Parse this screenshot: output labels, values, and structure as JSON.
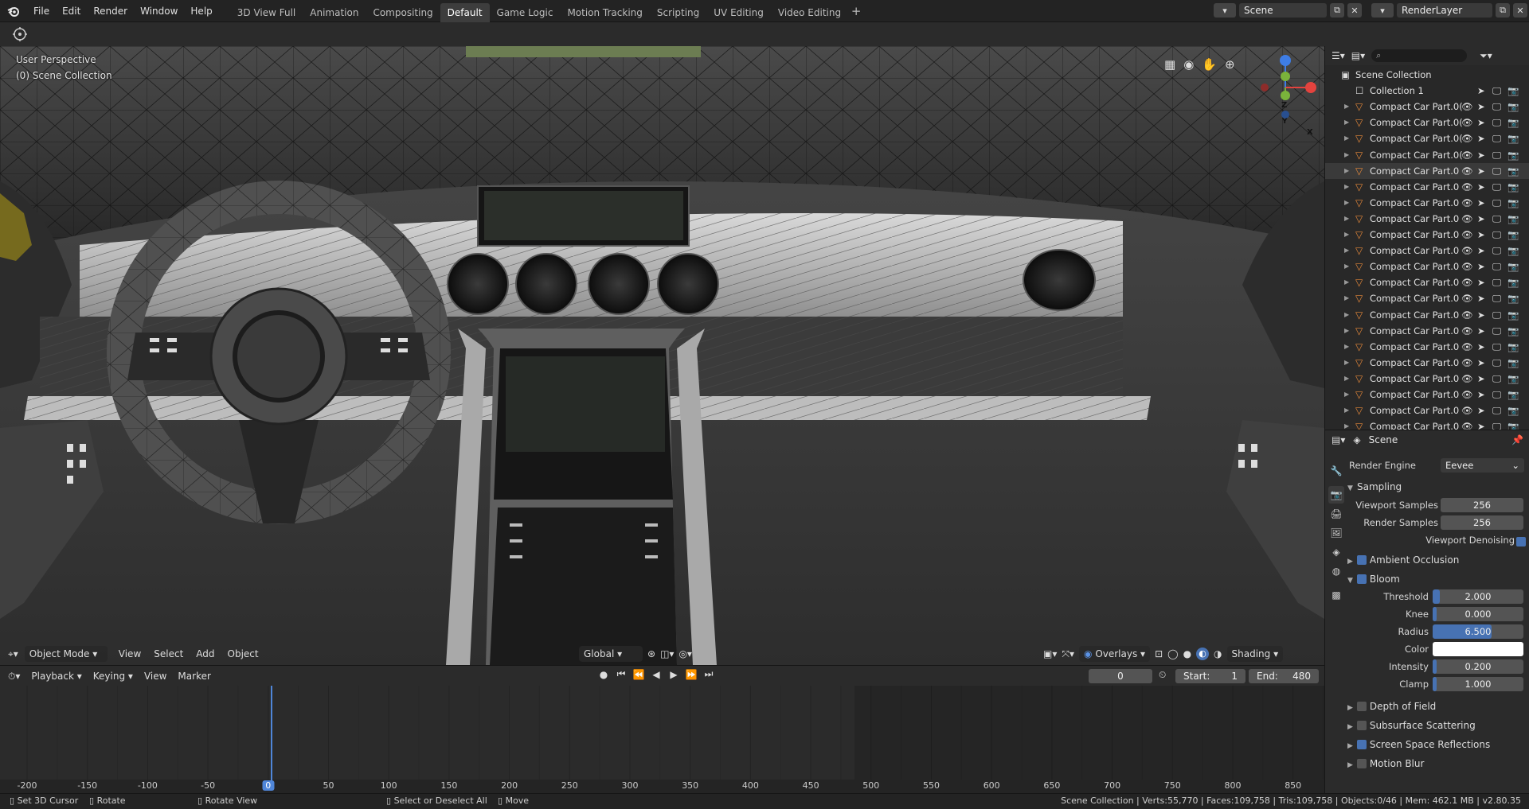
{
  "topbar": {
    "menus": [
      "File",
      "Edit",
      "Render",
      "Window",
      "Help"
    ],
    "workspaces": [
      "3D View Full",
      "Animation",
      "Compositing",
      "Default",
      "Game Logic",
      "Motion Tracking",
      "Scripting",
      "UV Editing",
      "Video Editing"
    ],
    "active_workspace": "Default",
    "add_tab": "+",
    "scene_name": "Scene",
    "view_layer": "RenderLayer"
  },
  "viewport": {
    "perspective": "User Perspective",
    "collection": "(0) Scene Collection",
    "mode": "Object Mode",
    "menus": [
      "View",
      "Select",
      "Add",
      "Object"
    ],
    "orientation": "Global",
    "overlays_label": "Overlays",
    "shading_label": "Shading",
    "gizmo_axes": {
      "z": "Z",
      "x": "X",
      "y": "Y"
    },
    "colors": {
      "x_axis": "#e4433e",
      "y_axis": "#7ab33b",
      "z_axis": "#3e7de6"
    }
  },
  "timeline": {
    "menus": [
      "Playback",
      "Keying",
      "View",
      "Marker"
    ],
    "current_frame": "0",
    "start_label": "Start:",
    "start_value": "1",
    "end_label": "End:",
    "end_value": "480",
    "ruler": [
      "-200",
      "-150",
      "-100",
      "-50",
      "0",
      "50",
      "100",
      "150",
      "200",
      "250",
      "300",
      "350",
      "400",
      "450",
      "500",
      "550",
      "600",
      "650",
      "700",
      "750",
      "800",
      "850"
    ],
    "playhead_color": "#4f86d9"
  },
  "statusbar": {
    "left": [
      {
        "icon": "mouse-left-icon",
        "label": "Set 3D Cursor"
      },
      {
        "icon": "mouse-middle-icon",
        "label": "Rotate"
      },
      {
        "icon": "mouse-right-icon",
        "label": "Rotate View"
      },
      {
        "icon": "mouse-left-icon",
        "label": "Select or Deselect All"
      },
      {
        "icon": "mouse-drag-icon",
        "label": "Move"
      }
    ],
    "stats": "Scene Collection | Verts:55,770 | Faces:109,758 | Tris:109,758 | Objects:0/46 | Mem: 462.1 MB | v2.80.35"
  },
  "outliner": {
    "root": "Scene Collection",
    "collection": "Collection 1",
    "items": [
      "Compact Car Part.0(",
      "Compact Car Part.0(",
      "Compact Car Part.0(",
      "Compact Car Part.0(",
      "Compact Car Part.0",
      "Compact Car Part.0",
      "Compact Car Part.0",
      "Compact Car Part.0",
      "Compact Car Part.0",
      "Compact Car Part.0",
      "Compact Car Part.0",
      "Compact Car Part.0",
      "Compact Car Part.0",
      "Compact Car Part.0",
      "Compact Car Part.0",
      "Compact Car Part.0",
      "Compact Car Part.0",
      "Compact Car Part.0",
      "Compact Car Part.0",
      "Compact Car Part.0",
      "Compact Car Part.0"
    ],
    "selected_index": 4,
    "mesh_color": "#e8893a"
  },
  "properties": {
    "context": "Scene",
    "render_engine_label": "Render Engine",
    "render_engine": "Eevee",
    "sampling": {
      "title": "Sampling",
      "viewport_samples_label": "Viewport Samples",
      "viewport_samples": "256",
      "render_samples_label": "Render Samples",
      "render_samples": "256",
      "denoising_label": "Viewport Denoising",
      "denoising": true
    },
    "ambient_occlusion": {
      "title": "Ambient Occlusion",
      "enabled": true
    },
    "bloom": {
      "title": "Bloom",
      "enabled": true,
      "threshold_label": "Threshold",
      "threshold": "2.000",
      "threshold_fill": 0.08,
      "knee_label": "Knee",
      "knee": "0.000",
      "knee_fill": 0.0,
      "radius_label": "Radius",
      "radius": "6.500",
      "radius_fill": 0.65,
      "color_label": "Color",
      "color": "#ffffff",
      "intensity_label": "Intensity",
      "intensity": "0.200",
      "intensity_fill": 0.0,
      "clamp_label": "Clamp",
      "clamp": "1.000",
      "clamp_fill": 0.02
    },
    "panels": [
      {
        "title": "Depth of Field",
        "enabled": false
      },
      {
        "title": "Subsurface Scattering",
        "enabled": false
      },
      {
        "title": "Screen Space Reflections",
        "enabled": true
      },
      {
        "title": "Motion Blur",
        "enabled": false
      }
    ],
    "accent": "#4772b3"
  }
}
